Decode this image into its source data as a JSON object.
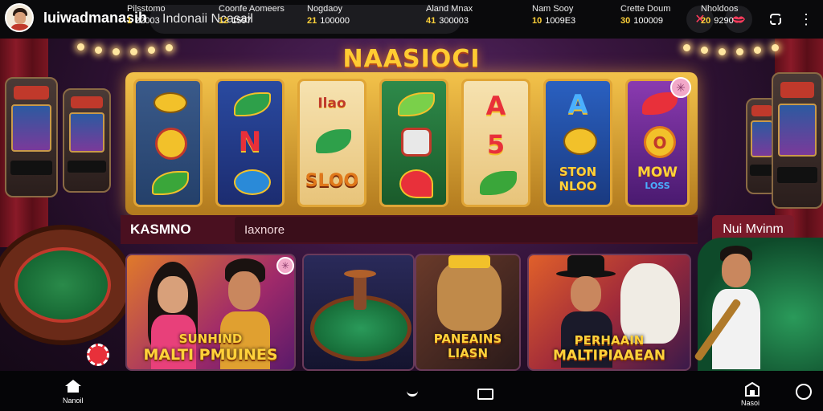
{
  "header": {
    "brand": "Iuiwadmanasih",
    "search_value": "Indonaii Ncasail",
    "icons": [
      "close-icon",
      "lips-icon",
      "refresh-icon",
      "more-icon"
    ]
  },
  "banner": {
    "title": "NAASIOCI"
  },
  "reels": {
    "col2_mid": "N",
    "col3_top": "Ilao",
    "col3_bottom": "SLOO",
    "col5_top": "A",
    "col5_mid": "5",
    "col6_top": "A",
    "col6_bottom_1": "STON",
    "col6_bottom_2": "NLOO",
    "col7_mid": "O",
    "col7_bottom_1": "MOW",
    "col7_bottom_2": "LOSS"
  },
  "category": {
    "label": "KASMNO",
    "tab": "Iaxnore",
    "right_pill": "Nui Mvinm"
  },
  "cards": {
    "card1_line1": "SUNHIND",
    "card1_line2": "MALTI PMUINES",
    "card3_line1": "PANEAINS",
    "card3_line2": "LIASN",
    "card4_line1": "PERHAAIN",
    "card4_line2": "MALTIPIAAEAN"
  },
  "bottom_nav": {
    "home_label": "Nanoil",
    "items": [
      {
        "label": "Pilsstomo",
        "num": "1",
        "value": "22003"
      },
      {
        "label": "Coonfe Aomeers",
        "num": "12",
        "value": "1597"
      },
      {
        "label": "Nogdaoy",
        "num": "21",
        "value": "100000"
      },
      {
        "label": "Aland Mnax",
        "num": "41",
        "value": "300003"
      },
      {
        "label": "Nam Sooy",
        "num": "10",
        "value": "1009E3"
      },
      {
        "label": "Crette Doum",
        "num": "30",
        "value": "100009"
      },
      {
        "label": "Nholdoos",
        "num": "20",
        "value": "9290"
      }
    ],
    "right_label": "Nasoi"
  }
}
